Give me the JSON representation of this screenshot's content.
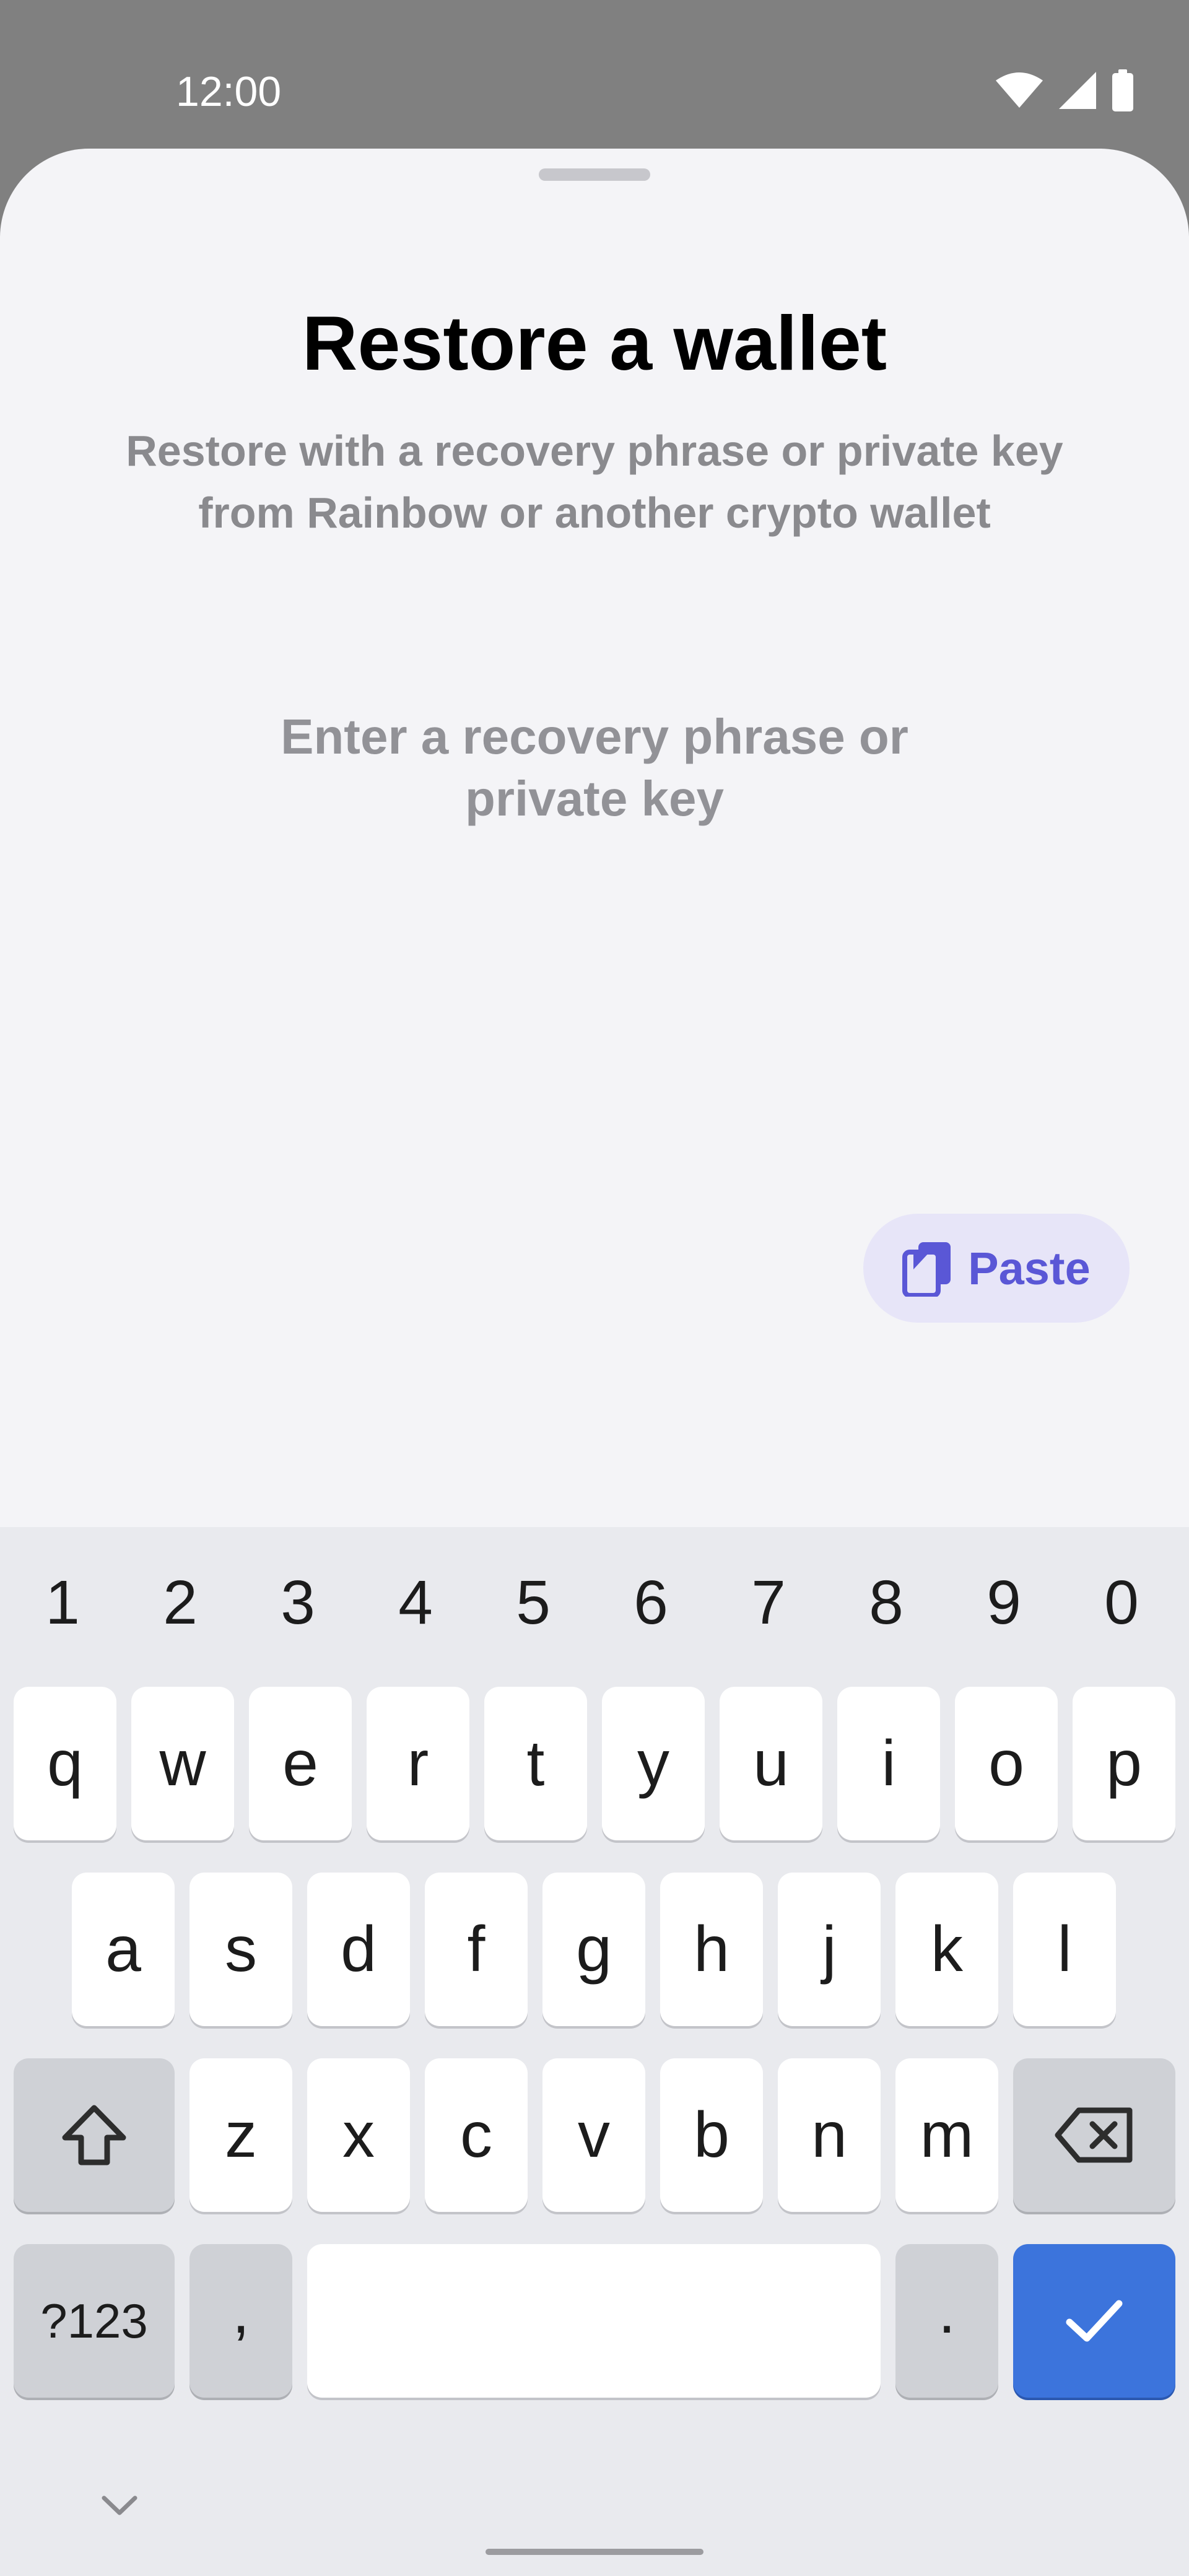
{
  "status_bar": {
    "time": "12:00",
    "icons": [
      "wifi-icon",
      "signal-icon",
      "battery-icon"
    ]
  },
  "sheet": {
    "title": "Restore a wallet",
    "subtitle_line1": "Restore with a recovery phrase or private key",
    "subtitle_line2": "from Rainbow or another crypto wallet",
    "input_placeholder_line1": "Enter a recovery phrase or",
    "input_placeholder_line2": "private key",
    "paste_label": "Paste",
    "paste_icon": "clipboard-icon"
  },
  "keyboard": {
    "numbers": [
      "1",
      "2",
      "3",
      "4",
      "5",
      "6",
      "7",
      "8",
      "9",
      "0"
    ],
    "row1": [
      "q",
      "w",
      "e",
      "r",
      "t",
      "y",
      "u",
      "i",
      "o",
      "p"
    ],
    "row2": [
      "a",
      "s",
      "d",
      "f",
      "g",
      "h",
      "j",
      "k",
      "l"
    ],
    "row3": [
      "z",
      "x",
      "c",
      "v",
      "b",
      "n",
      "m"
    ],
    "symbols_label": "?123",
    "comma": ",",
    "period": ".",
    "shift_icon": "shift-icon",
    "backspace_icon": "backspace-icon",
    "enter_icon": "checkmark-icon"
  },
  "colors": {
    "accent": "#5a57d6",
    "paste_bg": "#e7e5f8",
    "enter_key": "#3c74dc",
    "sheet_bg": "#f4f4f7"
  }
}
